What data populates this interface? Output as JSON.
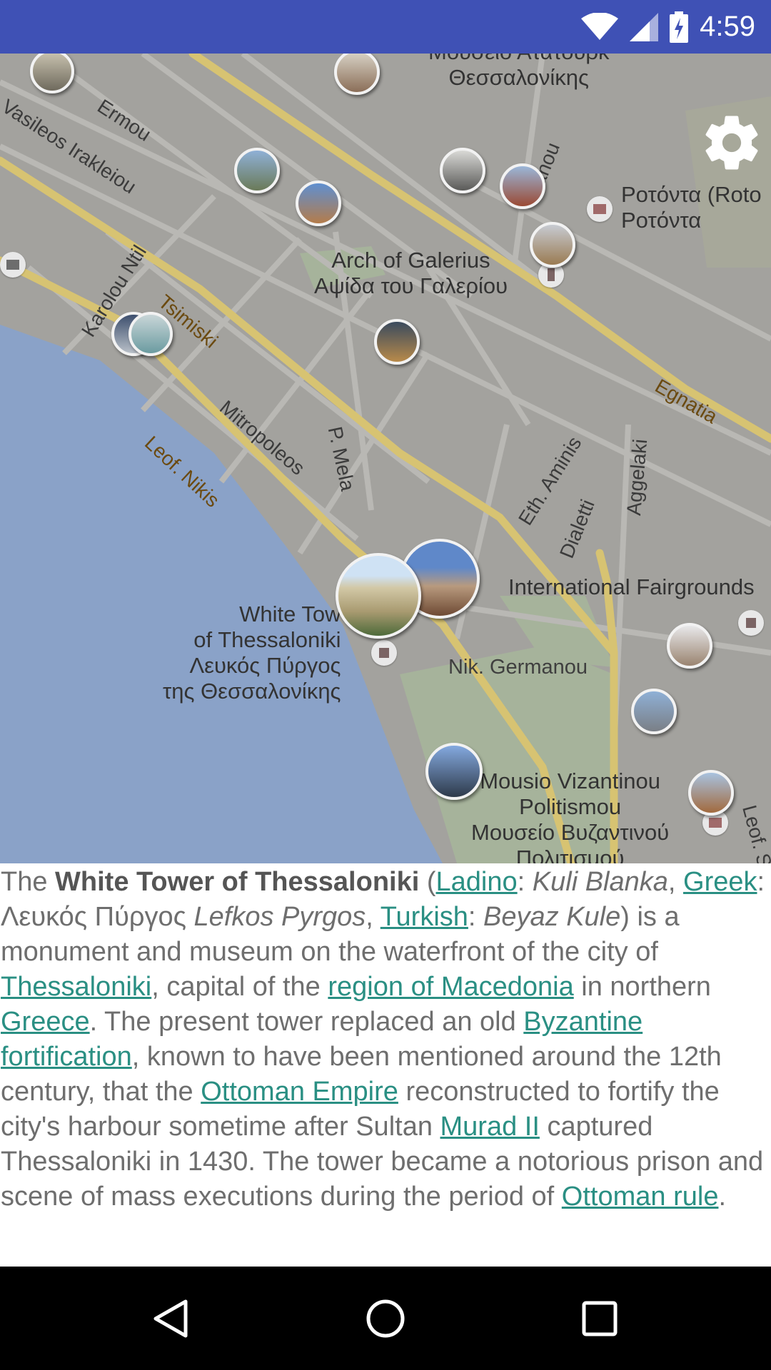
{
  "status_bar": {
    "time": "4:59",
    "wifi_icon": "wifi-icon",
    "signal_icon": "cell-signal-icon",
    "battery_icon": "battery-charging-icon"
  },
  "map": {
    "labels": {
      "museum_top": "Μουσείο Ατατούρκ\nΘεσσαλονίκης",
      "rotonda": "Ροτόντα (Roto\nΡοτόντα",
      "arch": "Arch of Galerius\nΑψίδα του Γαλερίου",
      "fairgrounds": "International Fairgrounds",
      "white_tower": "White Tow\nof Thessaloniki\nΛευκός Πύργος\nτης Θεσσαλονίκης",
      "nik_germanou": "Nik. Germanou",
      "byzantine_museum": "Mousio Vizantinou\nPolitismou\nΜουσείο Βυζαντινού\nΠολιτισμού"
    },
    "streets": {
      "vasileos": "Vasileos Irakleiou",
      "ermou": "Ermou",
      "karolou": "Karolou Ntil",
      "tsimiski": "Tsimiski",
      "mitropoleos": "Mitropoleos",
      "leof_nikis": "Leof. Nikis",
      "p_mela": "P. Mela",
      "eth_aminis": "Eth. Aminis",
      "dialetti": "Dialetti",
      "aggelaki": "Aggelaki",
      "egnatia": "Egnatia",
      "anou": "anou",
      "leof_s": "Leof. S"
    },
    "settings_icon": "gear-icon"
  },
  "article": {
    "t1": "The ",
    "title": "White Tower of Thessaloniki",
    "t2": " (",
    "ladino": "Ladino",
    "t3": ": ",
    "kuli": "Kuli Blanka",
    "t4": ", ",
    "greek": "Greek",
    "t5": ": Λευκός Πύργος ",
    "lefkos": "Lefkos Pyrgos",
    "t6": ", ",
    "turkish": "Turkish",
    "t7": ": ",
    "beyaz": "Beyaz Kule",
    "t8": ") is a monument and museum on the waterfront of the city of ",
    "thessaloniki": "Thessaloniki",
    "t9": ", capital of the ",
    "region": "region of Macedonia",
    "t10": " in northern ",
    "greece": "Greece",
    "t11": ". The present tower replaced an old ",
    "byzantine": "Byzantine",
    "t12": " ",
    "fortification": "fortification",
    "t13": ", known to have been mentioned around the 12th century, that the ",
    "ottoman_empire": "Ottoman Empire",
    "t14": " reconstructed to fortify the city's harbour sometime after Sultan ",
    "murad": "Murad II",
    "t15": " captured Thessaloniki in 1430. The tower became a notorious prison and scene of mass executions during the period of ",
    "ottoman_rule": "Ottoman rule",
    "t16": "."
  },
  "nav_bar": {
    "back_icon": "back-triangle-icon",
    "home_icon": "home-circle-icon",
    "recents_icon": "recents-square-icon"
  },
  "colors": {
    "status_bar": "#3f51b5",
    "link": "#2a8f83",
    "water": "#8aa2c8",
    "park": "#a9b39a",
    "road_major": "#d8c26a"
  }
}
